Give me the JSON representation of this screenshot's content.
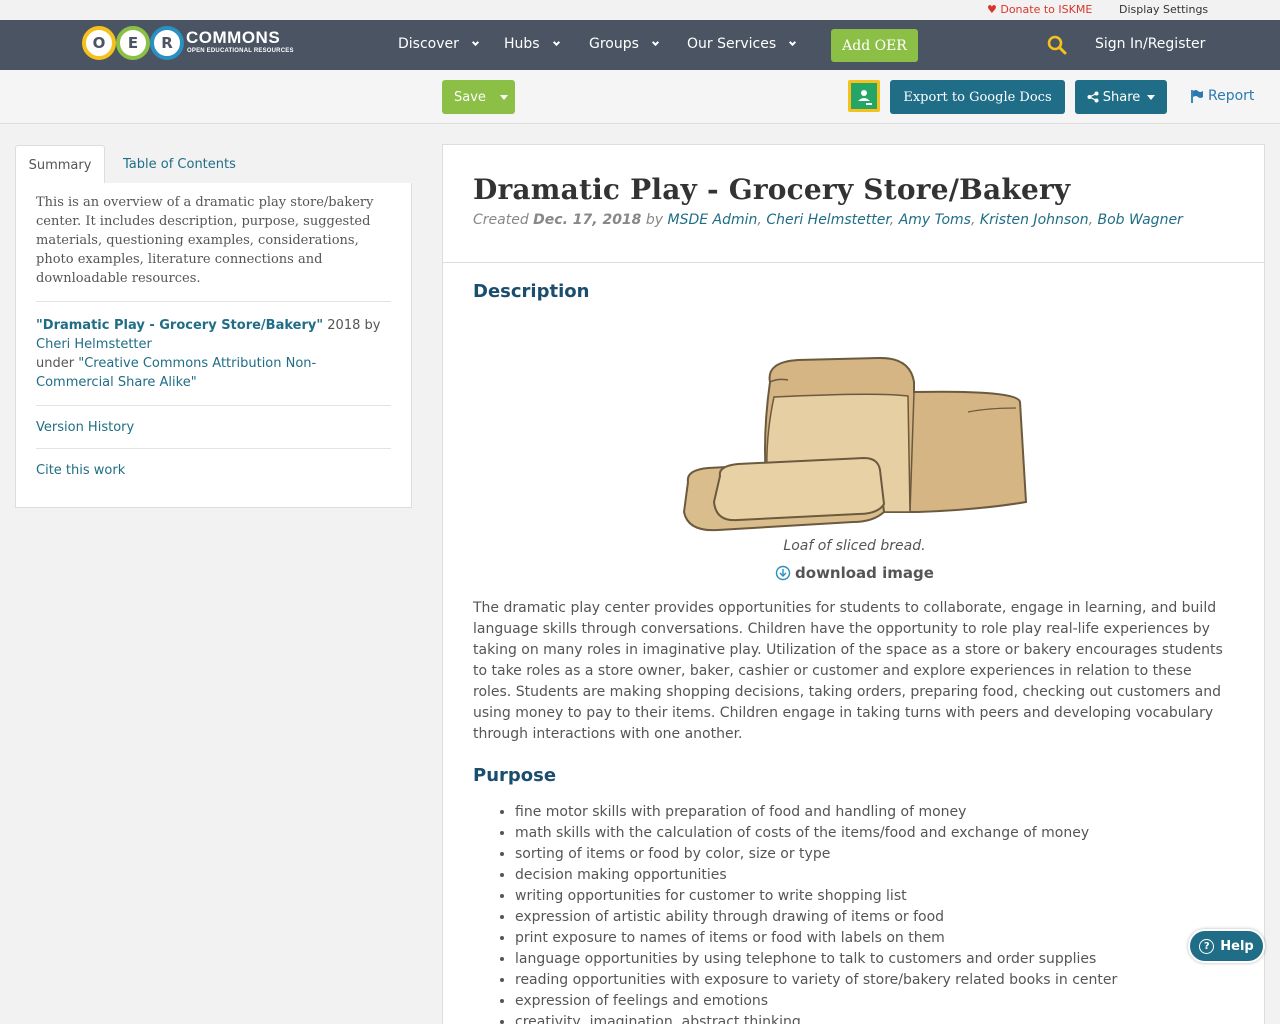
{
  "util": {
    "donate": "♥ Donate to ISKME",
    "display_settings": "Display Settings"
  },
  "nav": {
    "logo_letters": [
      "O",
      "E",
      "R"
    ],
    "logo_text": "COMMONS",
    "logo_sub": "OPEN EDUCATIONAL RESOURCES",
    "items": [
      "Discover",
      "Hubs",
      "Groups",
      "Our Services"
    ],
    "add_oer": "Add OER",
    "sign_in": "Sign In/Register"
  },
  "toolbar": {
    "save": "Save",
    "export": "Export to Google Docs",
    "share": "Share",
    "report": "Report"
  },
  "sidebar": {
    "tabs": [
      "Summary",
      "Table of Contents"
    ],
    "summary": "This is an overview of a dramatic play store/bakery center. It includes description, purpose, suggested materials, questioning examples, considerations, photo examples, literature connections and downloadable resources.",
    "attribution": {
      "title": "\"Dramatic Play - Grocery Store/Bakery\"",
      "year_by": " 2018 by ",
      "author": "Cheri Helmstetter",
      "under": "under ",
      "license": "\"Creative Commons Attribution Non-Commercial Share Alike\""
    },
    "version_history": "Version History",
    "cite": "Cite this work"
  },
  "main": {
    "title": "Dramatic Play - Grocery Store/Bakery",
    "created_label": "Created ",
    "created_date": "Dec. 17, 2018",
    "by": " by ",
    "authors": [
      "MSDE Admin",
      "Cheri Helmstetter",
      "Amy Toms",
      "Kristen Johnson",
      "Bob Wagner"
    ],
    "description_heading": "Description",
    "image_caption": "Loaf of sliced bread.",
    "download": "download image",
    "description": "The dramatic play center provides opportunities for students to collaborate, engage in learning, and build language skills through conversations.  Children have the opportunity to role play real-life experiences by taking on many roles in imaginative play. Utilization of the space as a store or bakery encourages students to take roles as a store owner, baker, cashier or customer and explore experiences in relation to these roles.  Students are making shopping decisions, taking orders, preparing food, checking out customers and using money to pay to their items. Children engage in taking turns with peers and developing vocabulary through interactions with one another.",
    "purpose_heading": "Purpose",
    "purpose_items": [
      "fine motor skills with preparation of food and handling of money",
      "math skills with the calculation of costs of the items/food and exchange of money",
      "sorting of items or food by color, size or type",
      "decision making opportunities",
      "writing opportunities for customer to write shopping list",
      "expression of artistic ability through drawing of items or food",
      "print exposure to names of items or food with labels on them",
      "language opportunities by using telephone to talk to customers and order supplies",
      "reading opportunities with exposure to variety of store/bakery related books in center",
      "expression of feelings and emotions",
      "creativity, imagination, abstract thinking"
    ]
  },
  "help": "Help",
  "colors": {
    "nav_bg": "#4a5463",
    "green": "#8cbf45",
    "teal": "#1f6d86",
    "heading": "#1a4d6e"
  }
}
